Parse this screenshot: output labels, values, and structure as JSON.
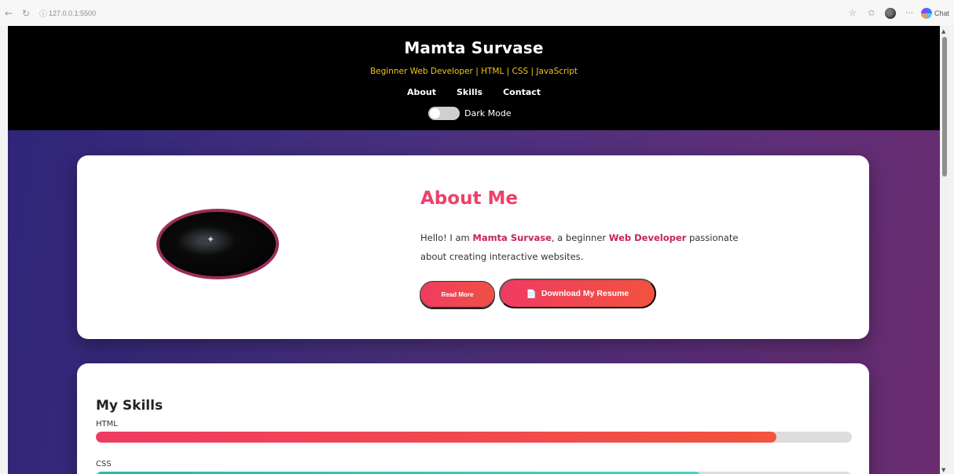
{
  "browser": {
    "url": "127.0.0.1:5500",
    "chat_label": "Chat",
    "icons": [
      "back-icon",
      "refresh-icon",
      "info-icon",
      "star-icon",
      "favorites-icon",
      "profile-icon",
      "more-icon",
      "copilot-icon"
    ]
  },
  "header": {
    "title": "Mamta Survase",
    "subtitle": "Beginner Web Developer | HTML | CSS | JavaScript",
    "nav": [
      "About",
      "Skills",
      "Contact"
    ],
    "toggle_label": "Dark Mode"
  },
  "about": {
    "title": "About Me",
    "text_prefix": "Hello! I am ",
    "name": "Mamta Survase",
    "text_mid": ", a beginner ",
    "role": "Web Developer",
    "text_suffix": " passionate about creating interactive websites.",
    "read_more": "Read More",
    "resume_icon": "📄",
    "resume": "Download My Resume"
  },
  "skills": {
    "title": "My Skills",
    "items": [
      {
        "name": "HTML",
        "level": 0.9,
        "color_from": "#ef3b62",
        "color_to": "#f2543f"
      },
      {
        "name": "CSS",
        "level": 0.8,
        "color_from": "#2ab5b0",
        "color_to": "#4ad0c8"
      }
    ]
  }
}
